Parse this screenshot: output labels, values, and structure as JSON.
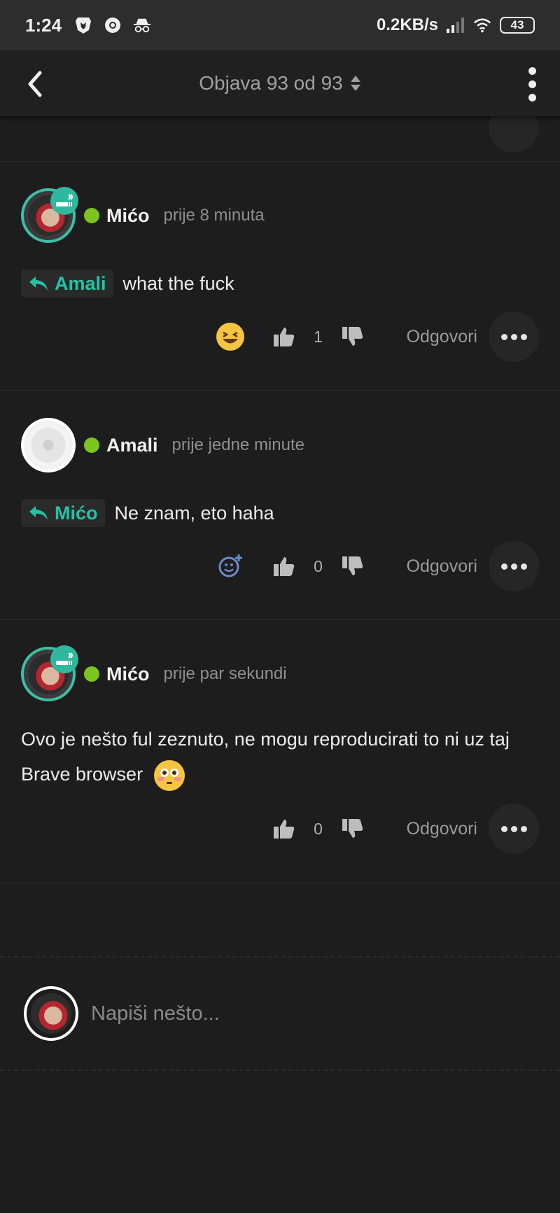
{
  "status_bar": {
    "time": "1:24",
    "left_icons": [
      "brave-lion-icon",
      "chrome-icon",
      "incognito-icon"
    ],
    "network_speed": "0.2KB/s",
    "right_icons": [
      "signal-icon",
      "wifi-icon"
    ],
    "battery": "43"
  },
  "app_bar": {
    "title": "Objava 93 od 93",
    "back_icon": "chevron-left-icon",
    "sort_icon": "updown-caret-icon",
    "menu_icon": "vertical-dots-icon"
  },
  "comments": [
    {
      "author": "Mićo",
      "time": "prije 8 minuta",
      "reply_to": "Amali",
      "text": "what the fuck",
      "reaction": "laughing-emoji",
      "likes": "1",
      "reply_label": "Odgovori"
    },
    {
      "author": "Amali",
      "time": "prije jedne minute",
      "reply_to": "Mićo",
      "text": "Ne znam, eto haha",
      "reaction": "add-reaction",
      "likes": "0",
      "reply_label": "Odgovori"
    },
    {
      "author": "Mićo",
      "time": "prije par sekundi",
      "reply_to": "",
      "text": "Ovo je nešto ful zeznuto, ne mogu reproducirati to ni uz taj Brave browser",
      "inline_emoji": "flushed-emoji",
      "likes": "0",
      "reply_label": "Odgovori"
    }
  ],
  "composer": {
    "placeholder": "Napiši nešto..."
  },
  "colors": {
    "accent": "#22c3a7",
    "online": "#7cc41e",
    "background": "#1d1d1d"
  }
}
